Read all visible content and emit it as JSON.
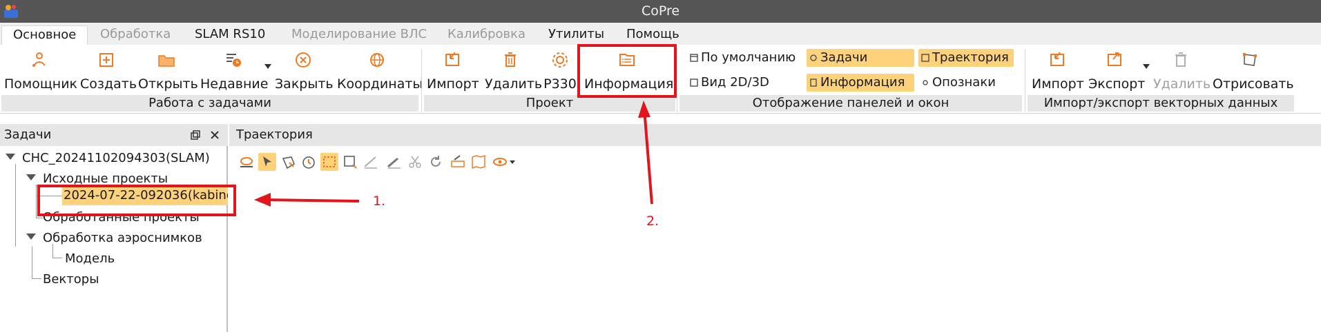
{
  "window": {
    "title": "CoPre"
  },
  "tabs": [
    {
      "label": "Основное",
      "state": "active"
    },
    {
      "label": "Обработка",
      "state": "disabled"
    },
    {
      "label": "SLAM RS10",
      "state": "normal"
    },
    {
      "label": "Моделирование ВЛС",
      "state": "disabled"
    },
    {
      "label": "Калибровка",
      "state": "disabled"
    },
    {
      "label": "Утилиты",
      "state": "normal"
    },
    {
      "label": "Помощь",
      "state": "normal"
    }
  ],
  "ribbon": {
    "tasks_group": {
      "label": "Работа с задачами",
      "buttons": [
        {
          "label": "Помощник",
          "icon": "wizard-icon"
        },
        {
          "label": "Создать",
          "icon": "create-icon"
        },
        {
          "label": "Открыть",
          "icon": "folder-open-icon"
        },
        {
          "label": "Недавние",
          "icon": "recent-icon"
        },
        {
          "label": "Закрыть",
          "icon": "close-circle-icon"
        },
        {
          "label": "Координаты",
          "icon": "globe-icon"
        }
      ]
    },
    "project_group": {
      "label": "Проект",
      "buttons": [
        {
          "label": "Импорт",
          "icon": "import-icon"
        },
        {
          "label": "Удалить",
          "icon": "trash-icon"
        },
        {
          "label": "P330",
          "icon": "settings-icon"
        },
        {
          "label": "Информация",
          "icon": "info-doc-icon"
        }
      ]
    },
    "display_group": {
      "label": "Отображение панелей и окон",
      "items": [
        {
          "label": "По умолчанию",
          "active": false
        },
        {
          "label": "Задачи",
          "active": true
        },
        {
          "label": "Траектория",
          "active": true
        },
        {
          "label": "Вид 2D/3D",
          "active": false
        },
        {
          "label": "Информация",
          "active": true
        },
        {
          "label": "Опознаки",
          "active": false
        }
      ]
    },
    "vector_group": {
      "label": "Импорт/экспорт векторных данных",
      "buttons": [
        {
          "label": "Импорт",
          "icon": "import-icon",
          "disabled": false
        },
        {
          "label": "Экспорт",
          "icon": "export-icon",
          "disabled": false
        },
        {
          "label": "Удалить",
          "icon": "trash-icon",
          "disabled": true
        },
        {
          "label": "Отрисовать",
          "icon": "draw-polygon-icon",
          "disabled": false
        }
      ]
    }
  },
  "tasks_panel": {
    "title": "Задачи",
    "tree": {
      "root": "CHC_20241102094303(SLAM)",
      "source_projects": "Исходные проекты",
      "source_item": "2024-07-22-092036(kabine",
      "processed_projects": "Обработанные проекты",
      "aerial": "Обработка аэроснимков",
      "model": "Модель",
      "vectors": "Векторы"
    }
  },
  "trajectory_panel": {
    "title": "Траектория"
  },
  "annotations": {
    "label1": "1.",
    "label2": "2."
  },
  "colors": {
    "accent_highlight": "#fdd27a",
    "annotation_red": "#e3141b",
    "titlebar": "#555555",
    "icon_orange": "#f07a22"
  }
}
